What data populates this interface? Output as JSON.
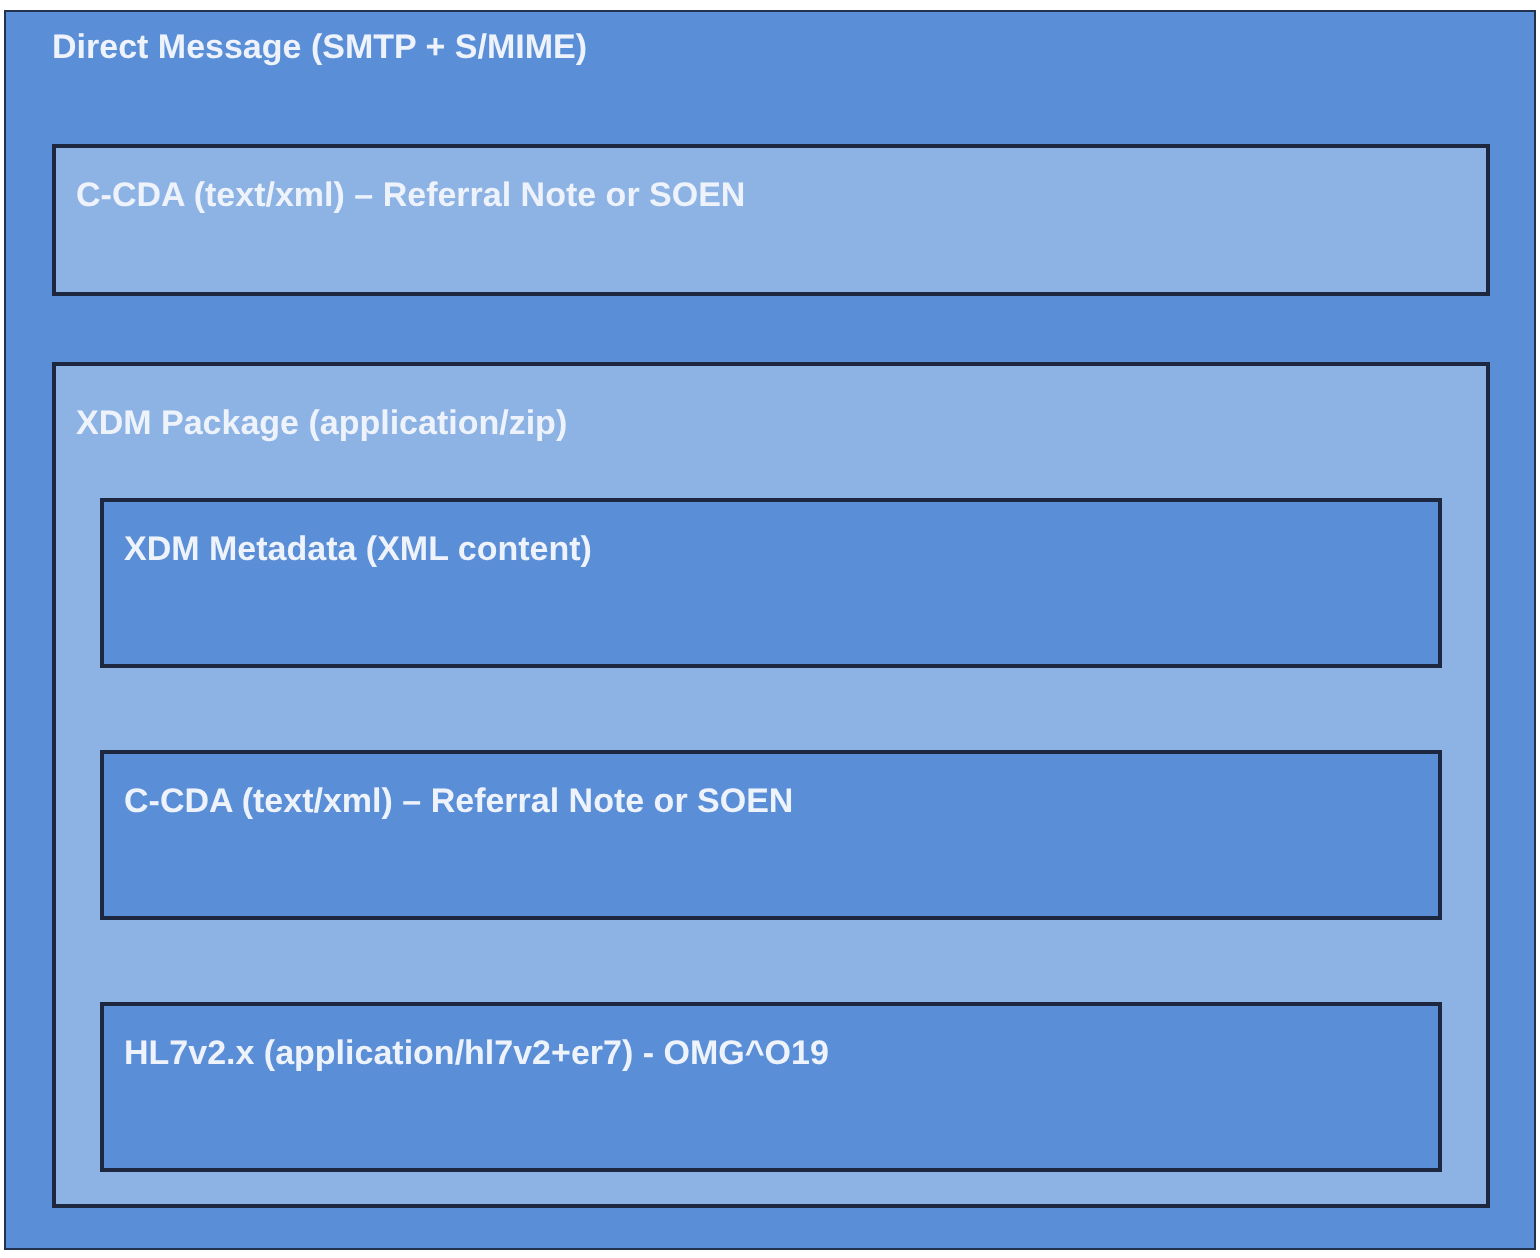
{
  "diagram": {
    "title": "Direct Message (SMTP + S/MIME)",
    "sections": [
      {
        "kind": "part",
        "label": "C-CDA (text/xml) – Referral Note or SOEN"
      },
      {
        "kind": "package",
        "label": "XDM Package (application/zip)",
        "children": [
          {
            "label": "XDM Metadata (XML content)"
          },
          {
            "label": "C-CDA (text/xml) – Referral Note or SOEN"
          },
          {
            "label": "HL7v2.x (application/hl7v2+er7) - OMG^O19"
          }
        ]
      }
    ]
  }
}
